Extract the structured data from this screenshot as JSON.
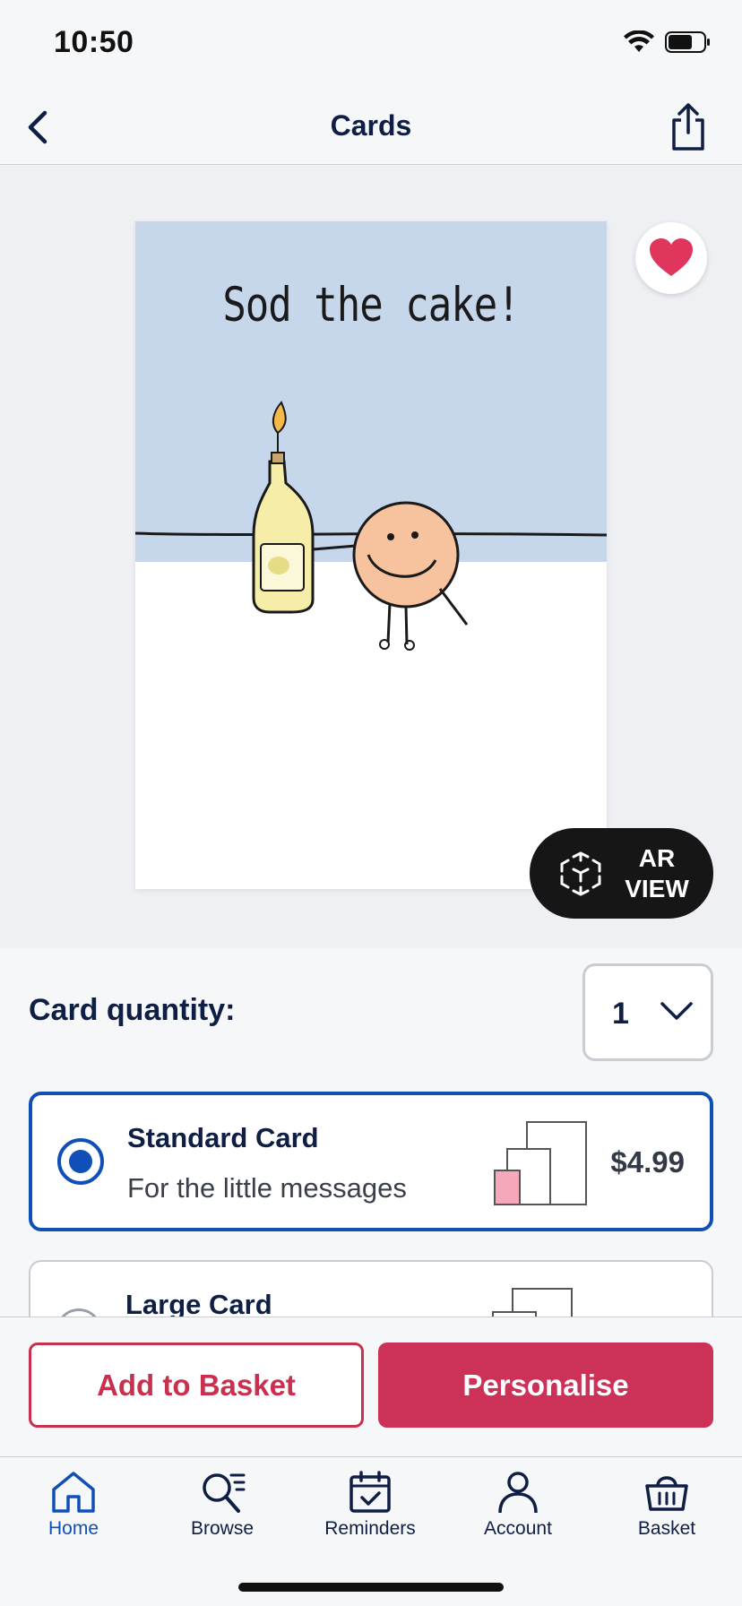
{
  "status": {
    "time": "10:50"
  },
  "nav": {
    "title": "Cards",
    "back_icon": "chevron-left-icon",
    "share_icon": "share-icon"
  },
  "card": {
    "text": "Sod the cake!"
  },
  "ar": {
    "line1": "AR",
    "line2": "VIEW"
  },
  "quantity": {
    "label": "Card quantity:",
    "value": "1"
  },
  "options": [
    {
      "title": "Standard Card",
      "subtitle": "For the little messages",
      "price": "$4.99",
      "selected": true
    },
    {
      "title": "Large Card",
      "selected": false
    }
  ],
  "actions": {
    "add": "Add to Basket",
    "personalise": "Personalise"
  },
  "tabs": [
    {
      "label": "Home",
      "icon": "home-icon",
      "active": true
    },
    {
      "label": "Browse",
      "icon": "browse-icon",
      "active": false
    },
    {
      "label": "Reminders",
      "icon": "calendar-icon",
      "active": false
    },
    {
      "label": "Account",
      "icon": "user-icon",
      "active": false
    },
    {
      "label": "Basket",
      "icon": "basket-icon",
      "active": false
    }
  ],
  "colors": {
    "accent": "#0f4fb6",
    "brand": "#cc3157",
    "heart": "#e0355c",
    "navy": "#0f1f44"
  }
}
